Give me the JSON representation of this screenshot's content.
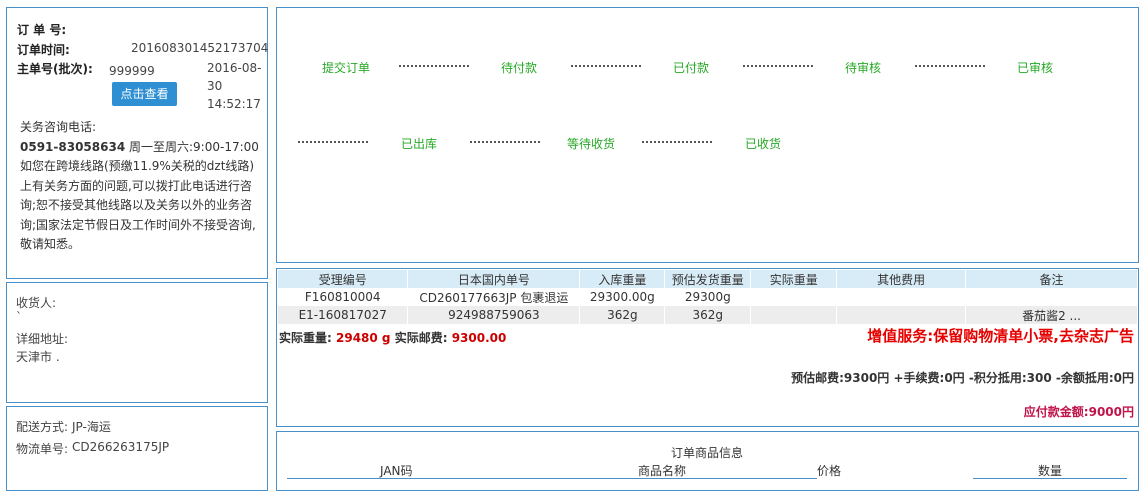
{
  "order": {
    "order_no_label": "订 单 号:",
    "order_time_label": "订单时间:",
    "order_time_value": "201608301452173704",
    "master_no_label": "主单号(批次):",
    "master_no_value": "999999",
    "date_line1": "2016-08-",
    "date_line2": "30",
    "date_line3": "14:52:17",
    "view_button": "点击查看",
    "consult_title": "关务咨询电话:",
    "consult_phone": "0591-83058634",
    "consult_hours": " 周一至周六:9:00-17:00",
    "consult_text": "如您在跨境线路(预缴11.9%关税的dzt线路)上有关务方面的问题,可以拨打此电话进行咨询;恕不接受其他线路以及关务以外的业务咨询;国家法定节假日及工作时间外不接受咨询,敬请知悉。"
  },
  "receiver": {
    "name_label": "收货人:",
    "name_value": "`",
    "address_label": "详细地址:",
    "address_value": "天津市 ."
  },
  "shipping": {
    "method_label": "配送方式:",
    "method_value": "JP-海运",
    "tracking_label": "物流单号:",
    "tracking_value": "CD266263175JP"
  },
  "status_flow": {
    "row1": [
      "提交订单",
      "待付款",
      "已付款",
      "待审核",
      "已审核"
    ],
    "row2": [
      "已出库",
      "等待收货",
      "已收货"
    ]
  },
  "detail_table": {
    "headers": [
      "受理编号",
      "日本国内单号",
      "入库重量",
      "预估发货重量",
      "实际重量",
      "其他费用",
      "备注"
    ],
    "rows": [
      [
        "F160810004",
        "CD260177663JP 包裹退运",
        "29300.00g",
        "29300g",
        "",
        "",
        ""
      ],
      [
        "E1-160817027",
        "924988759063",
        "362g",
        "362g",
        "",
        "",
        "番茄酱2 ..."
      ]
    ]
  },
  "summary": {
    "actual_weight_label": "实际重量:",
    "actual_weight_value": "29480 g",
    "actual_postage_label": "实际邮费:",
    "actual_postage_value": "9300.00",
    "promo": "增值服务:保留购物清单小票,去杂志广告",
    "fees": "预估邮费:9300円 +手续费:0円 -积分抵用:300 -余额抵用:0円",
    "due_label": "应付款金额:",
    "due_value": "9000円"
  },
  "goods": {
    "title": "订单商品信息",
    "headers": [
      "JAN码",
      "商品名称",
      "价格",
      "数量"
    ]
  }
}
